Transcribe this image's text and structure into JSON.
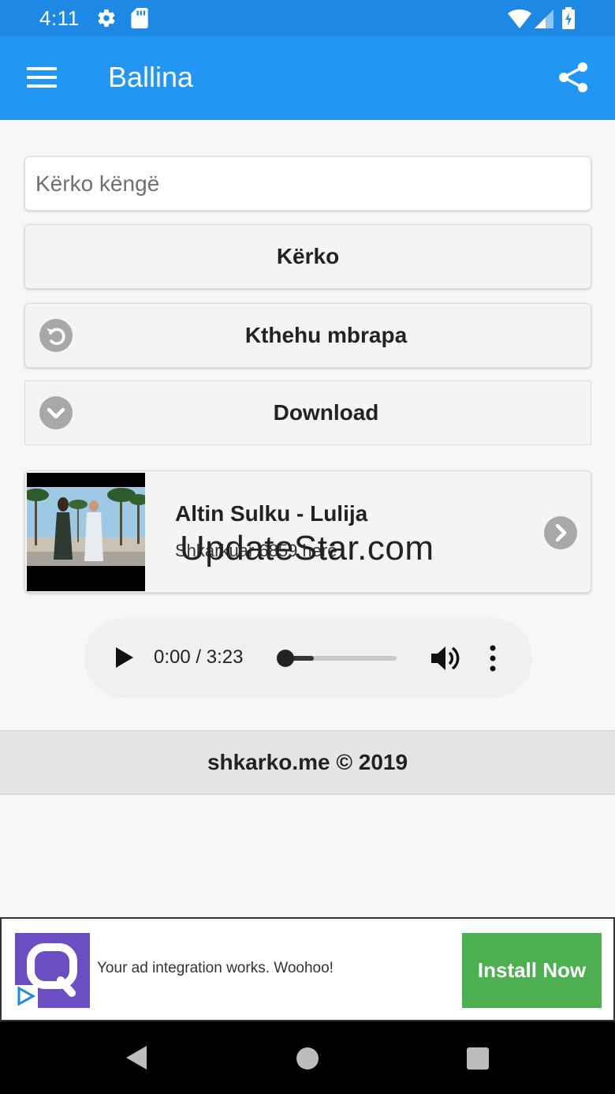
{
  "status_bar": {
    "time": "4:11",
    "icons": [
      "gear-icon",
      "sd-card-icon",
      "wifi-icon",
      "signal-icon",
      "battery-charging-icon"
    ]
  },
  "app_bar": {
    "title": "Ballina",
    "menu_icon": "hamburger-menu-icon",
    "share_icon": "share-icon",
    "color": "#2196f3"
  },
  "search": {
    "placeholder": "Kërko këngë",
    "value": ""
  },
  "buttons": {
    "search_label": "Kërko",
    "back_label": "Kthehu mbrapa",
    "back_icon": "undo-circle-icon",
    "download_label": "Download",
    "download_icon": "chevron-down-circle-icon"
  },
  "song_card": {
    "title": "Altin Sulku - Lulija",
    "subtitle": "Shkarkuar 6859 herë",
    "watermark": "UpdateStar.com",
    "arrow_icon": "chevron-right-circle-icon"
  },
  "audio_player": {
    "time": "0:00 / 3:23",
    "progress": 0.0,
    "buffered": 0.3,
    "icons": [
      "play-icon",
      "volume-icon",
      "more-vertical-icon"
    ]
  },
  "footer": {
    "text": "shkarko.me © 2019"
  },
  "ad": {
    "text": "Your ad integration works. Woohoo!",
    "cta": "Install Now",
    "cta_color": "#4caf50",
    "logo_color": "#6b4ec2"
  },
  "nav_bar": {
    "icons": [
      "back-triangle-icon",
      "home-circle-icon",
      "recents-square-icon"
    ]
  }
}
